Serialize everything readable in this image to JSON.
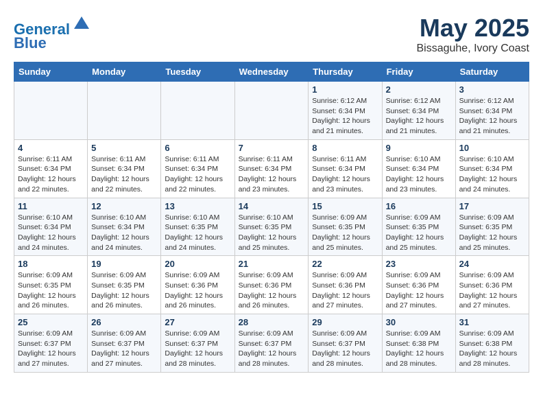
{
  "header": {
    "logo_line1": "General",
    "logo_line2": "Blue",
    "title": "May 2025",
    "subtitle": "Bissaguhe, Ivory Coast"
  },
  "days_of_week": [
    "Sunday",
    "Monday",
    "Tuesday",
    "Wednesday",
    "Thursday",
    "Friday",
    "Saturday"
  ],
  "weeks": [
    [
      {
        "day": "",
        "info": ""
      },
      {
        "day": "",
        "info": ""
      },
      {
        "day": "",
        "info": ""
      },
      {
        "day": "",
        "info": ""
      },
      {
        "day": "1",
        "info": "Sunrise: 6:12 AM\nSunset: 6:34 PM\nDaylight: 12 hours\nand 21 minutes."
      },
      {
        "day": "2",
        "info": "Sunrise: 6:12 AM\nSunset: 6:34 PM\nDaylight: 12 hours\nand 21 minutes."
      },
      {
        "day": "3",
        "info": "Sunrise: 6:12 AM\nSunset: 6:34 PM\nDaylight: 12 hours\nand 21 minutes."
      }
    ],
    [
      {
        "day": "4",
        "info": "Sunrise: 6:11 AM\nSunset: 6:34 PM\nDaylight: 12 hours\nand 22 minutes."
      },
      {
        "day": "5",
        "info": "Sunrise: 6:11 AM\nSunset: 6:34 PM\nDaylight: 12 hours\nand 22 minutes."
      },
      {
        "day": "6",
        "info": "Sunrise: 6:11 AM\nSunset: 6:34 PM\nDaylight: 12 hours\nand 22 minutes."
      },
      {
        "day": "7",
        "info": "Sunrise: 6:11 AM\nSunset: 6:34 PM\nDaylight: 12 hours\nand 23 minutes."
      },
      {
        "day": "8",
        "info": "Sunrise: 6:11 AM\nSunset: 6:34 PM\nDaylight: 12 hours\nand 23 minutes."
      },
      {
        "day": "9",
        "info": "Sunrise: 6:10 AM\nSunset: 6:34 PM\nDaylight: 12 hours\nand 23 minutes."
      },
      {
        "day": "10",
        "info": "Sunrise: 6:10 AM\nSunset: 6:34 PM\nDaylight: 12 hours\nand 24 minutes."
      }
    ],
    [
      {
        "day": "11",
        "info": "Sunrise: 6:10 AM\nSunset: 6:34 PM\nDaylight: 12 hours\nand 24 minutes."
      },
      {
        "day": "12",
        "info": "Sunrise: 6:10 AM\nSunset: 6:34 PM\nDaylight: 12 hours\nand 24 minutes."
      },
      {
        "day": "13",
        "info": "Sunrise: 6:10 AM\nSunset: 6:35 PM\nDaylight: 12 hours\nand 24 minutes."
      },
      {
        "day": "14",
        "info": "Sunrise: 6:10 AM\nSunset: 6:35 PM\nDaylight: 12 hours\nand 25 minutes."
      },
      {
        "day": "15",
        "info": "Sunrise: 6:09 AM\nSunset: 6:35 PM\nDaylight: 12 hours\nand 25 minutes."
      },
      {
        "day": "16",
        "info": "Sunrise: 6:09 AM\nSunset: 6:35 PM\nDaylight: 12 hours\nand 25 minutes."
      },
      {
        "day": "17",
        "info": "Sunrise: 6:09 AM\nSunset: 6:35 PM\nDaylight: 12 hours\nand 25 minutes."
      }
    ],
    [
      {
        "day": "18",
        "info": "Sunrise: 6:09 AM\nSunset: 6:35 PM\nDaylight: 12 hours\nand 26 minutes."
      },
      {
        "day": "19",
        "info": "Sunrise: 6:09 AM\nSunset: 6:35 PM\nDaylight: 12 hours\nand 26 minutes."
      },
      {
        "day": "20",
        "info": "Sunrise: 6:09 AM\nSunset: 6:36 PM\nDaylight: 12 hours\nand 26 minutes."
      },
      {
        "day": "21",
        "info": "Sunrise: 6:09 AM\nSunset: 6:36 PM\nDaylight: 12 hours\nand 26 minutes."
      },
      {
        "day": "22",
        "info": "Sunrise: 6:09 AM\nSunset: 6:36 PM\nDaylight: 12 hours\nand 27 minutes."
      },
      {
        "day": "23",
        "info": "Sunrise: 6:09 AM\nSunset: 6:36 PM\nDaylight: 12 hours\nand 27 minutes."
      },
      {
        "day": "24",
        "info": "Sunrise: 6:09 AM\nSunset: 6:36 PM\nDaylight: 12 hours\nand 27 minutes."
      }
    ],
    [
      {
        "day": "25",
        "info": "Sunrise: 6:09 AM\nSunset: 6:37 PM\nDaylight: 12 hours\nand 27 minutes."
      },
      {
        "day": "26",
        "info": "Sunrise: 6:09 AM\nSunset: 6:37 PM\nDaylight: 12 hours\nand 27 minutes."
      },
      {
        "day": "27",
        "info": "Sunrise: 6:09 AM\nSunset: 6:37 PM\nDaylight: 12 hours\nand 28 minutes."
      },
      {
        "day": "28",
        "info": "Sunrise: 6:09 AM\nSunset: 6:37 PM\nDaylight: 12 hours\nand 28 minutes."
      },
      {
        "day": "29",
        "info": "Sunrise: 6:09 AM\nSunset: 6:37 PM\nDaylight: 12 hours\nand 28 minutes."
      },
      {
        "day": "30",
        "info": "Sunrise: 6:09 AM\nSunset: 6:38 PM\nDaylight: 12 hours\nand 28 minutes."
      },
      {
        "day": "31",
        "info": "Sunrise: 6:09 AM\nSunset: 6:38 PM\nDaylight: 12 hours\nand 28 minutes."
      }
    ]
  ]
}
